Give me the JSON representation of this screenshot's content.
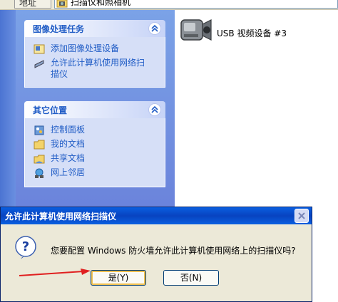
{
  "address": {
    "label": "地址 (D)",
    "path": "扫描仪和照相机",
    "folder_icon": "folder-camera-icon"
  },
  "tasks_panel": {
    "title": "图像处理任务",
    "items": [
      {
        "label": "添加图像处理设备",
        "icon": "add-device-icon"
      },
      {
        "label": "允许此计算机使用网络扫描仪",
        "icon": "network-scanner-icon"
      }
    ]
  },
  "places_panel": {
    "title": "其它位置",
    "items": [
      {
        "label": "控制面板",
        "icon": "control-panel-icon"
      },
      {
        "label": "我的文档",
        "icon": "my-documents-icon"
      },
      {
        "label": "共享文档",
        "icon": "shared-documents-icon"
      },
      {
        "label": "网上邻居",
        "icon": "network-places-icon"
      }
    ]
  },
  "device": {
    "label": "USB 视频设备 #3",
    "icon": "video-camera-icon"
  },
  "dialog": {
    "title": "允许此计算机使用网络扫描仪",
    "message": "您要配置 Windows 防火墙允许此计算机使用网络上的扫描仪吗?",
    "yes_label": "是(Y)",
    "no_label": "否(N)",
    "icon": "question-icon"
  },
  "colors": {
    "title_blue": "#0a5fe0",
    "link_blue": "#215dc6",
    "arrow_red": "#e02020"
  }
}
